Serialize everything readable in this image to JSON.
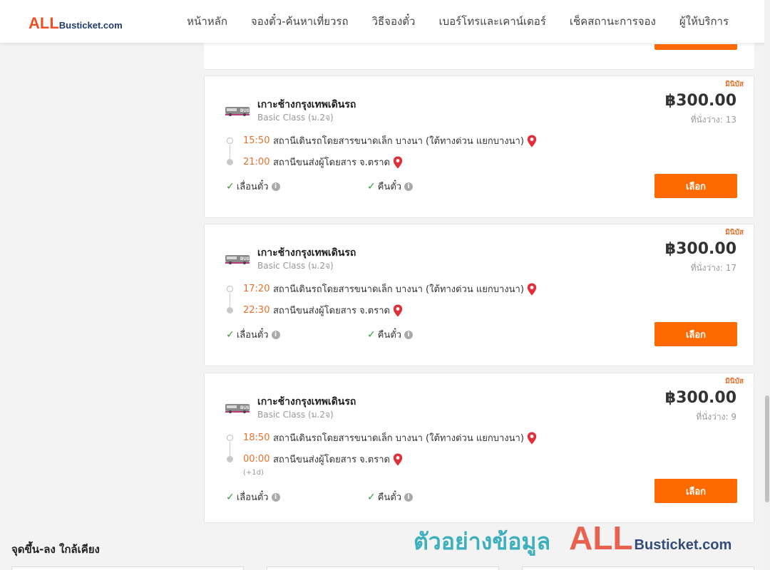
{
  "header": {
    "logo_prefix": "ALL",
    "logo_suffix": "Busticket.com",
    "nav": [
      {
        "label": "หน้าหลัก"
      },
      {
        "label": "จองตั๋ว-ค้นหาเที่ยวรถ"
      },
      {
        "label": "วิธีจองตั๋ว"
      },
      {
        "label": "เบอร์โทรและเคาน์เตอร์"
      },
      {
        "label": "เช็คสถานะการจอง"
      },
      {
        "label": "ผู้ให้บริการ"
      }
    ]
  },
  "trips": [
    {
      "badge": "มินิบัส",
      "operator": "เกาะช้างกรุงเทพเดินรถ",
      "class": "Basic Class (ม.2จ)",
      "price": "฿300.00",
      "seats": "ที่นั่งว่าง: 13",
      "dep_time": "15:50",
      "dep_station": "สถานีเดินรถโดยสารขนาดเล็ก บางนา (ใต้ทางด่วน แยกบางนา)",
      "arr_time": "21:00",
      "arr_station": "สถานีขนส่งผู้โดยสาร จ.ตราด",
      "next_day": "",
      "feature_1": "เลื่อนตั๋ว",
      "feature_2": "คืนตั๋ว",
      "select_label": "เลือก"
    },
    {
      "badge": "มินิบัส",
      "operator": "เกาะช้างกรุงเทพเดินรถ",
      "class": "Basic Class (ม.2จ)",
      "price": "฿300.00",
      "seats": "ที่นั่งว่าง: 17",
      "dep_time": "17:20",
      "dep_station": "สถานีเดินรถโดยสารขนาดเล็ก บางนา (ใต้ทางด่วน แยกบางนา)",
      "arr_time": "22:30",
      "arr_station": "สถานีขนส่งผู้โดยสาร จ.ตราด",
      "next_day": "",
      "feature_1": "เลื่อนตั๋ว",
      "feature_2": "คืนตั๋ว",
      "select_label": "เลือก"
    },
    {
      "badge": "มินิบัส",
      "operator": "เกาะช้างกรุงเทพเดินรถ",
      "class": "Basic Class (ม.2จ)",
      "price": "฿300.00",
      "seats": "ที่นั่งว่าง: 9",
      "dep_time": "18:50",
      "dep_station": "สถานีเดินรถโดยสารขนาดเล็ก บางนา (ใต้ทางด่วน แยกบางนา)",
      "arr_time": "00:00",
      "arr_station": "สถานีขนส่งผู้โดยสาร จ.ตราด",
      "next_day": "(+1d)",
      "feature_1": "เลื่อนตั๋ว",
      "feature_2": "คืนตั๋ว",
      "select_label": "เลือก"
    }
  ],
  "nearby": {
    "title": "จุดขึ้น-ลง ใกล้เคียง"
  },
  "watermark": {
    "text": "ตัวอย่างข้อมูล",
    "logo_prefix": "ALL",
    "logo_suffix": "Busticket.com"
  },
  "colors": {
    "accent": "#ff6a00",
    "time": "#e8702a",
    "check": "#2e9e3a",
    "pin": "#e0313a"
  }
}
